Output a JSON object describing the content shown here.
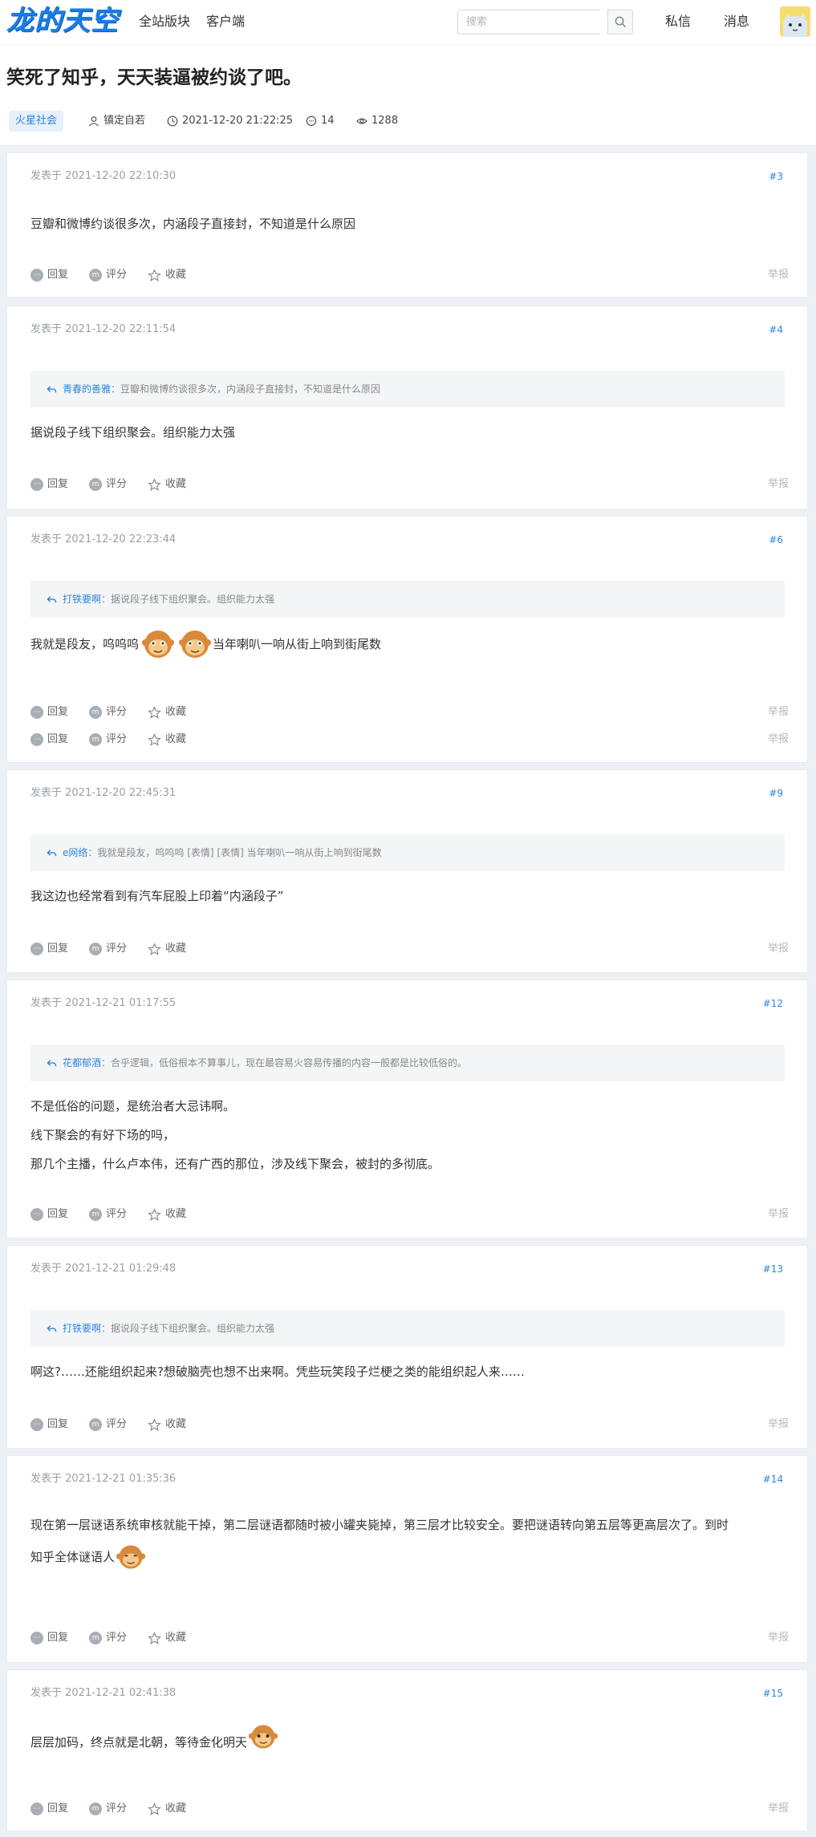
{
  "header": {
    "logo": "龙的天空",
    "nav": [
      "全站版块",
      "客户端"
    ],
    "search_placeholder": "搜索",
    "messages": "私信",
    "notifications": "消息"
  },
  "thread": {
    "title": "笑死了知乎，天天装逼被约谈了吧。",
    "forum": "火星社会",
    "author": "镇定自若",
    "time": "2021-12-20 21:22:25",
    "replies": "14",
    "views": "1288"
  },
  "actions": {
    "reply": "回复",
    "rate": "评分",
    "favorite": "收藏",
    "report": "举报"
  },
  "posts": [
    {
      "time": "发表于 2021-12-20 22:10:30",
      "floor": "#3",
      "lines": [
        "豆瓣和微博约谈很多次，内涵段子直接封，不知道是什么原因"
      ]
    },
    {
      "time": "发表于 2021-12-20 22:11:54",
      "floor": "#4",
      "quote_user": "青春的善雅",
      "quote_text": "：豆瓣和微博约谈很多次，内涵段子直接封，不知道是什么原因",
      "lines": [
        "据说段子线下组织聚会。组织能力太强"
      ]
    },
    {
      "time": "发表于 2021-12-20 22:23:44",
      "floor": "#6",
      "quote_user": "打铁要啊",
      "quote_text": "：据说段子线下组织聚会。组织能力太强",
      "line_a": "我就是段友，呜呜呜",
      "line_b": "当年喇叭一响从街上响到街尾数"
    },
    {
      "time": "发表于 2021-12-20 22:45:31",
      "floor": "#9",
      "quote_user": "e网络",
      "quote_text": "：我就是段友，呜呜呜 [表情] [表情] 当年喇叭一响从街上响到街尾数",
      "lines": [
        "我这边也经常看到有汽车屁股上印着“内涵段子”"
      ]
    },
    {
      "time": "发表于 2021-12-21 01:17:55",
      "floor": "#12",
      "quote_user": "花都郁酒",
      "quote_text": "：合乎逻辑，低俗根本不算事儿，现在最容易火容易传播的内容一般都是比较低俗的。",
      "lines": [
        "不是低俗的问题，是统治者大忌讳啊。",
        "线下聚会的有好下场的吗，",
        "那几个主播，什么卢本伟，还有广西的那位，涉及线下聚会，被封的多彻底。"
      ]
    },
    {
      "time": "发表于 2021-12-21 01:29:48",
      "floor": "#13",
      "quote_user": "打铁要啊",
      "quote_text": "：据说段子线下组织聚会。组织能力太强",
      "lines": [
        "啊这?……还能组织起来?想破脑壳也想不出来啊。凭些玩笑段子烂梗之类的能组织起人来……"
      ]
    },
    {
      "time": "发表于 2021-12-21 01:35:36",
      "floor": "#14",
      "line_a": "现在第一层谜语系统审核就能干掉，第二层谜语都随时被小罐夹毙掉，第三层才比较安全。要把谜语转向第五层等更高层次了。到时",
      "line_b": "知乎全体谜语人"
    },
    {
      "time": "发表于 2021-12-21 02:41:38",
      "floor": "#15",
      "line_a": "层层加码，终点就是北朝，等待金化明天"
    }
  ]
}
